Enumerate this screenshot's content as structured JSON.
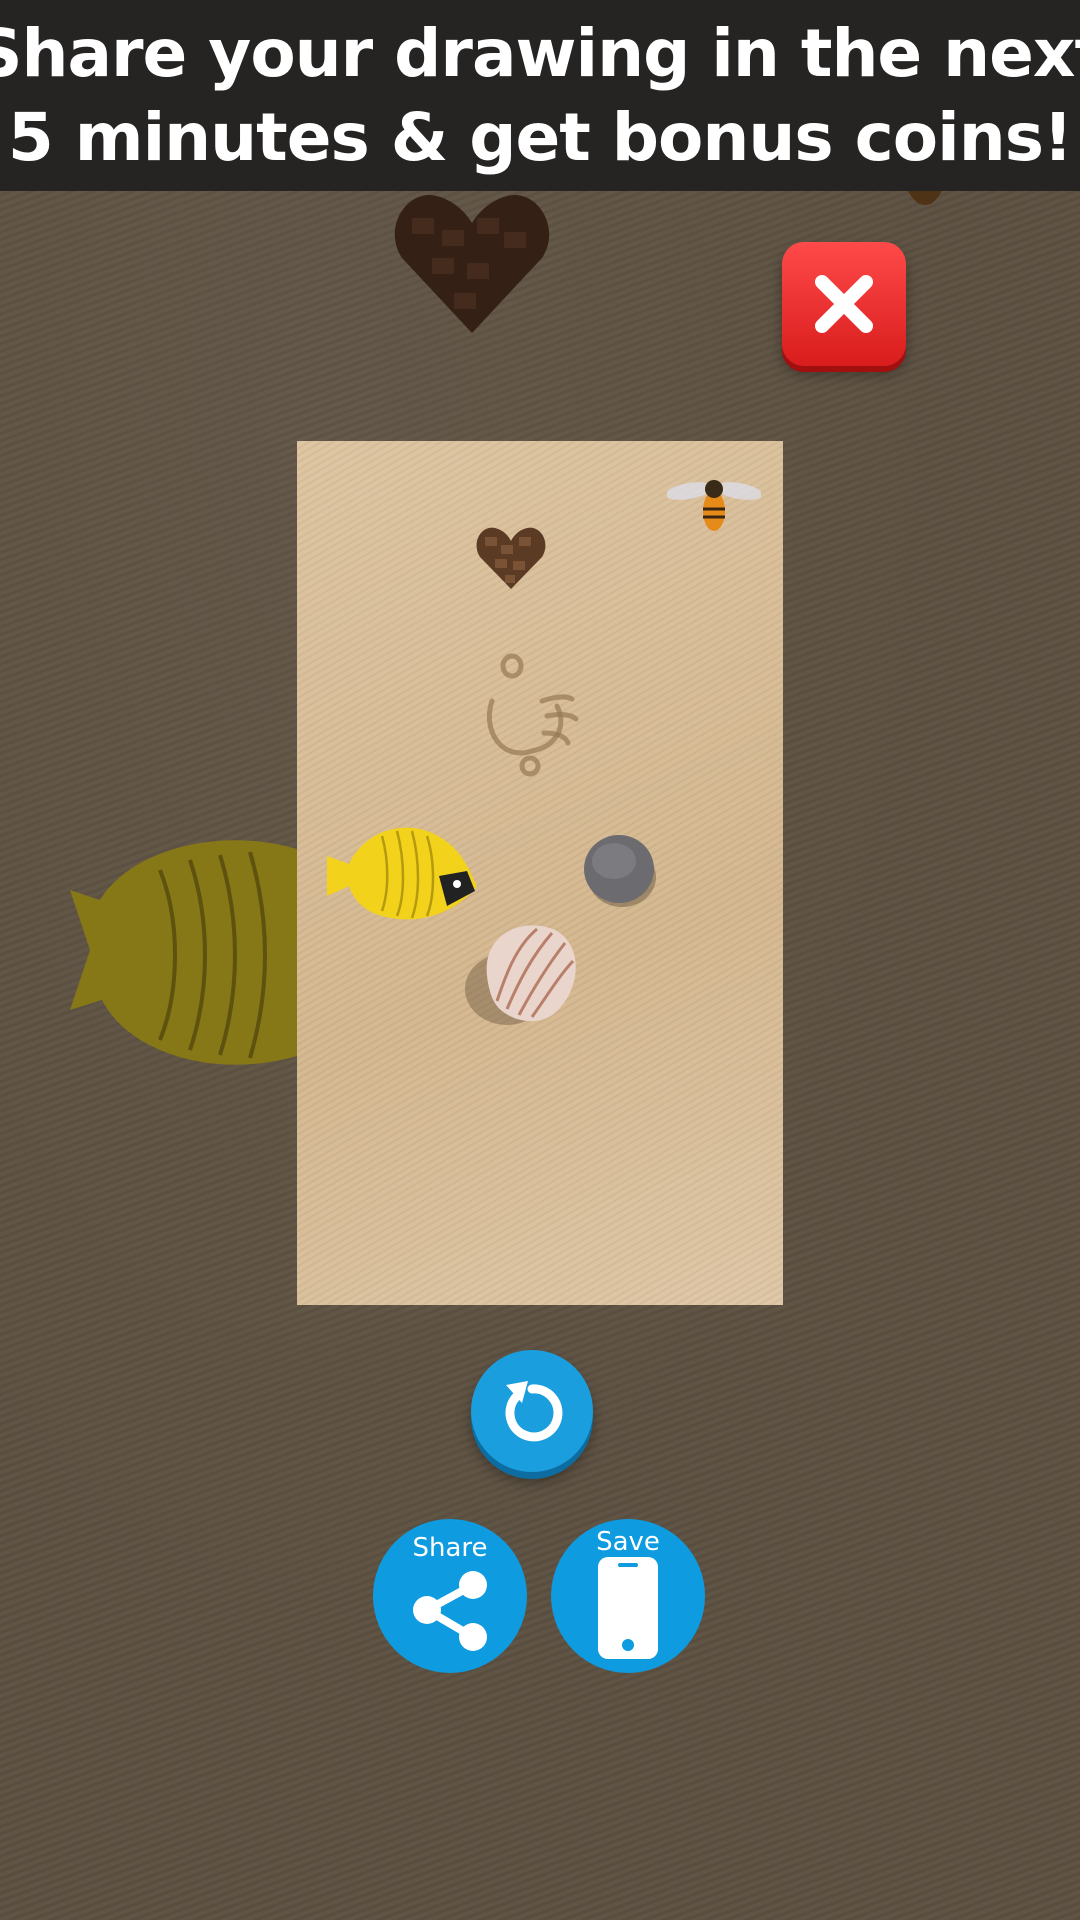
{
  "banner": {
    "line1": "Share your drawing in the next",
    "line2": "5 minutes & get bonus coins!"
  },
  "close_button": {
    "icon": "close-x-icon",
    "color": "#e52222"
  },
  "canvas": {
    "items": [
      "heart-of-chocolate",
      "bee",
      "handprint",
      "yellow-fish",
      "stone",
      "seashell"
    ]
  },
  "replay_button": {
    "icon": "replay-icon",
    "color": "#1a9ede"
  },
  "share_button": {
    "label": "Share",
    "icon": "share-icon",
    "color": "#0e9be0"
  },
  "save_button": {
    "label": "Save",
    "icon": "phone-icon",
    "color": "#0e9be0"
  }
}
